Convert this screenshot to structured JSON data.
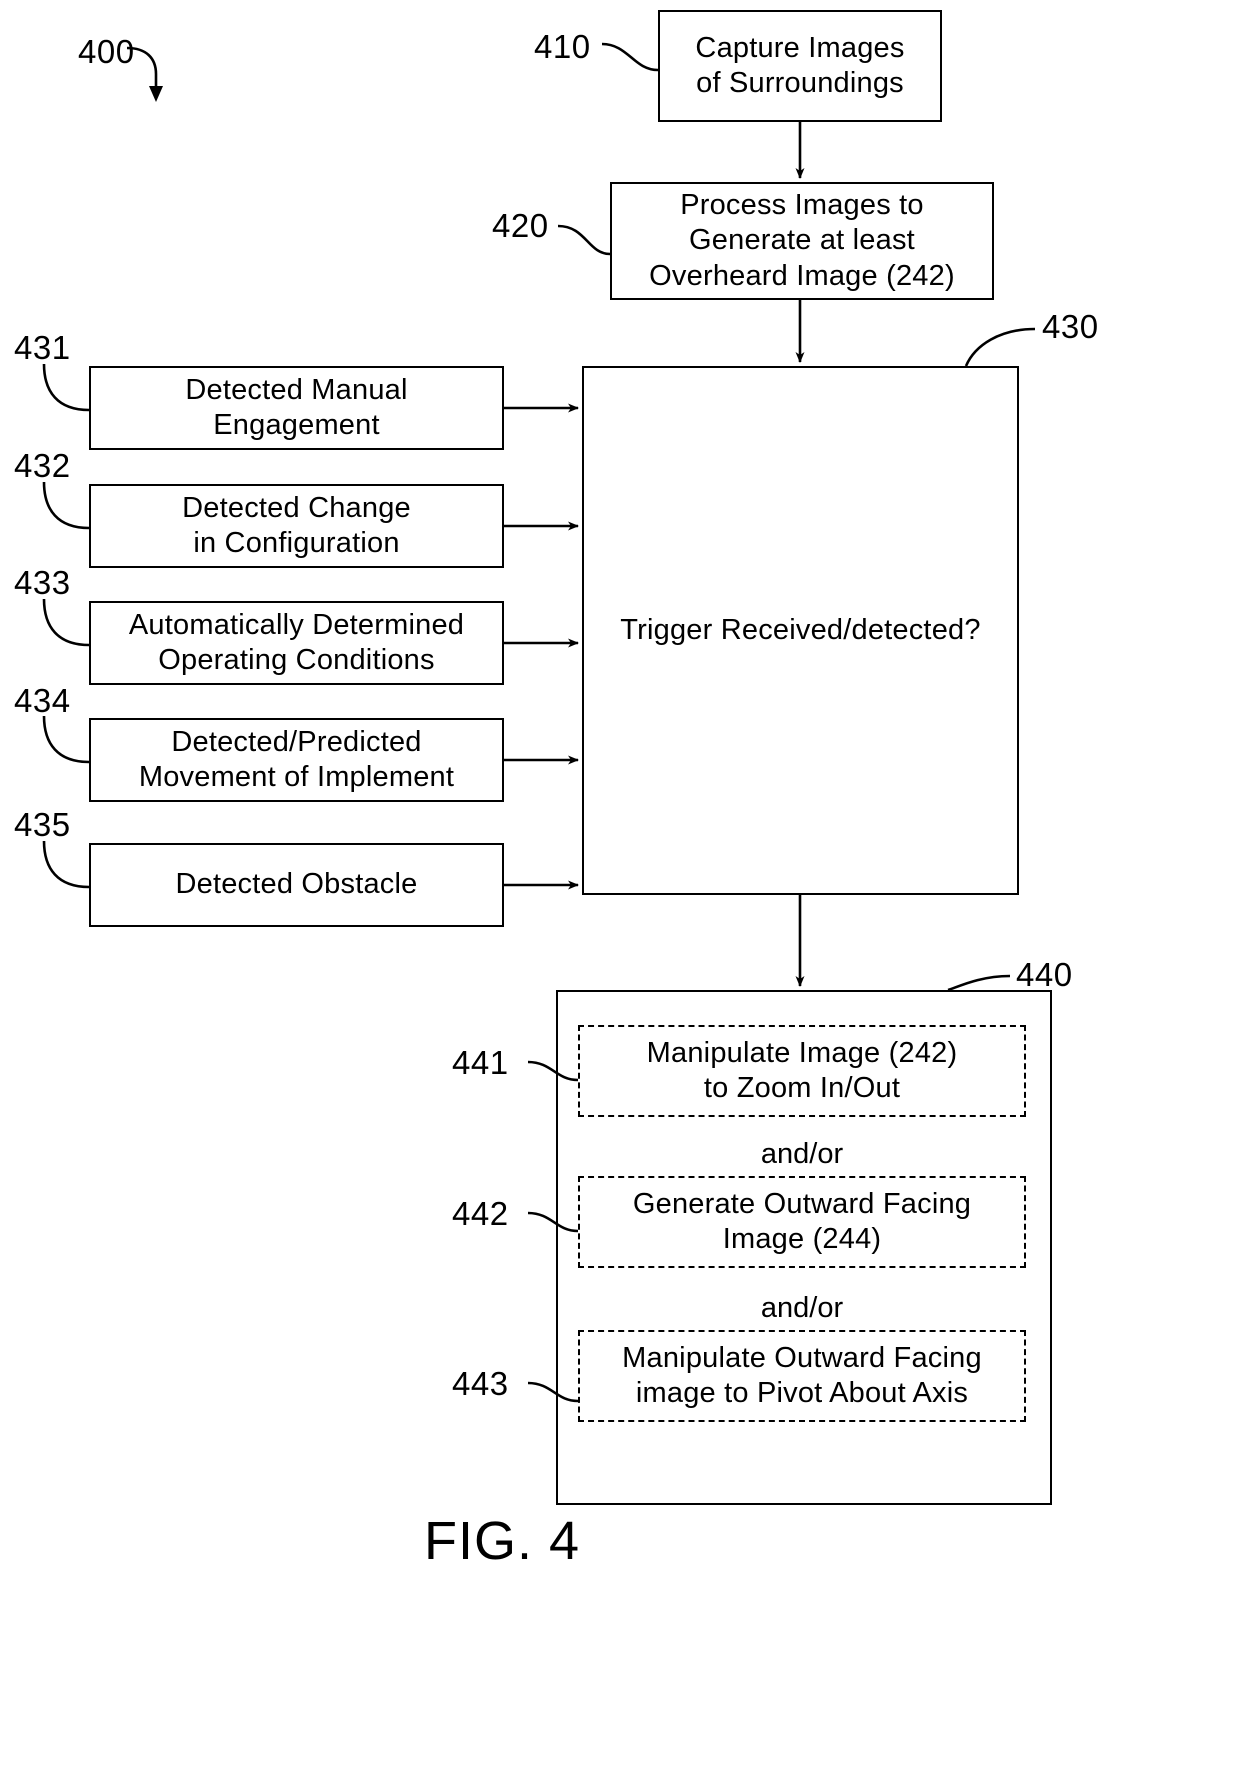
{
  "figure": {
    "caption": "FIG. 4",
    "diagram_ref": "400"
  },
  "nodes": [
    {
      "ref": "410",
      "name": "capture-images",
      "text": "Capture Images\nof Surroundings",
      "style": "solid"
    },
    {
      "ref": "420",
      "name": "process-images",
      "text": "Process Images to\nGenerate at least\nOverheard Image (242)",
      "style": "solid"
    },
    {
      "ref": "430",
      "name": "trigger-decision",
      "text": "Trigger Received/detected?",
      "style": "solid"
    },
    {
      "ref": "431",
      "name": "detected-manual-engagement",
      "text": "Detected Manual\nEngagement",
      "style": "solid"
    },
    {
      "ref": "432",
      "name": "detected-change-in-configuration",
      "text": "Detected Change\nin Configuration",
      "style": "solid"
    },
    {
      "ref": "433",
      "name": "automatically-determined-operating-conditions",
      "text": "Automatically Determined\nOperating Conditions",
      "style": "solid"
    },
    {
      "ref": "434",
      "name": "detected-predicted-movement-of-implement",
      "text": "Detected/Predicted\nMovement of Implement",
      "style": "solid"
    },
    {
      "ref": "435",
      "name": "detected-obstacle",
      "text": "Detected Obstacle",
      "style": "solid"
    },
    {
      "ref": "440",
      "name": "image-manipulation-group",
      "text": "",
      "style": "solid"
    },
    {
      "ref": "441",
      "name": "manipulate-image-zoom",
      "text": "Manipulate Image (242)\nto Zoom In/Out",
      "style": "dashed"
    },
    {
      "ref": "442",
      "name": "generate-outward-facing-image",
      "text": "Generate Outward Facing\nImage (244)",
      "style": "dashed"
    },
    {
      "ref": "443",
      "name": "manipulate-outward-facing-image-pivot",
      "text": "Manipulate Outward Facing\nimage to Pivot About Axis",
      "style": "dashed"
    }
  ],
  "connectors": {
    "and_or_1": "and/or",
    "and_or_2": "and/or"
  }
}
